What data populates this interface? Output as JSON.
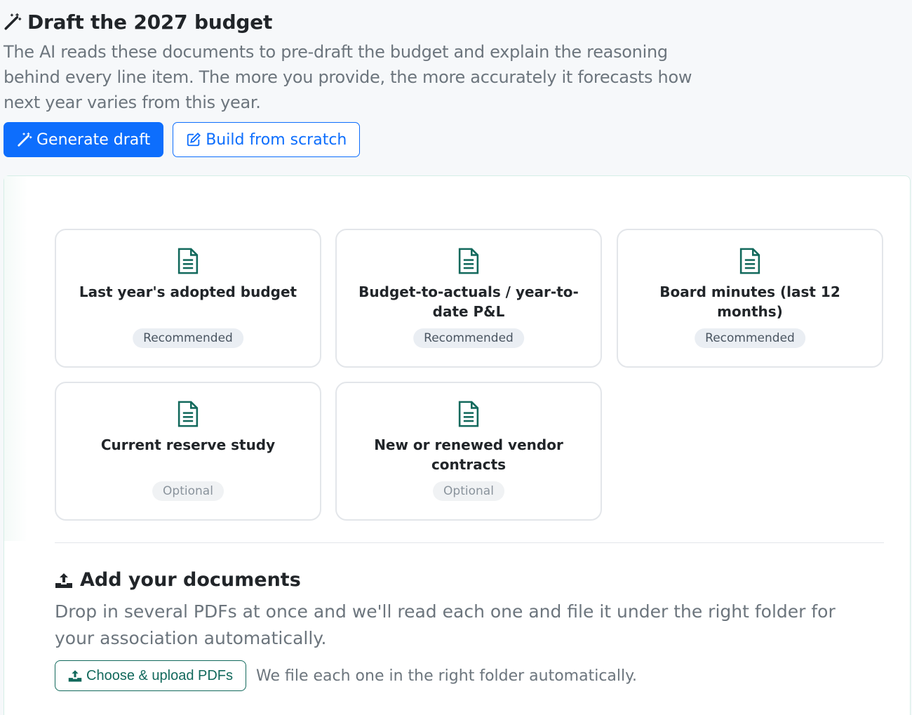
{
  "header": {
    "title": "Draft the 2027 budget",
    "intro": "The AI reads these documents to pre-draft the budget and explain the reasoning behind every line item. The more you provide, the more accurately it forecasts how next year varies from this year."
  },
  "actions": {
    "generate_label": "Generate draft",
    "scratch_label": "Build from scratch"
  },
  "documents": [
    {
      "title": "Last year's adopted budget",
      "badge": "Recommended",
      "badge_kind": "recommended"
    },
    {
      "title": "Budget-to-actuals / year-to-date P&L",
      "badge": "Recommended",
      "badge_kind": "recommended"
    },
    {
      "title": "Board minutes (last 12 months)",
      "badge": "Recommended",
      "badge_kind": "recommended"
    },
    {
      "title": "Current reserve study",
      "badge": "Optional",
      "badge_kind": "optional"
    },
    {
      "title": "New or renewed vendor contracts",
      "badge": "Optional",
      "badge_kind": "optional"
    }
  ],
  "upload": {
    "title": "Add your documents",
    "description": "Drop in several PDFs at once and we'll read each one and file it under the right folder for your association automatically.",
    "button_label": "Choose & upload PDFs",
    "note": "We file each one in the right folder automatically."
  },
  "colors": {
    "primary": "#0d6efd",
    "teal": "#12695c",
    "muted_text": "#6c757d"
  },
  "icons": {
    "title": "magic-wand-icon",
    "generate": "magic-wand-icon",
    "scratch": "edit-icon",
    "document": "file-text-icon",
    "upload": "upload-icon"
  }
}
